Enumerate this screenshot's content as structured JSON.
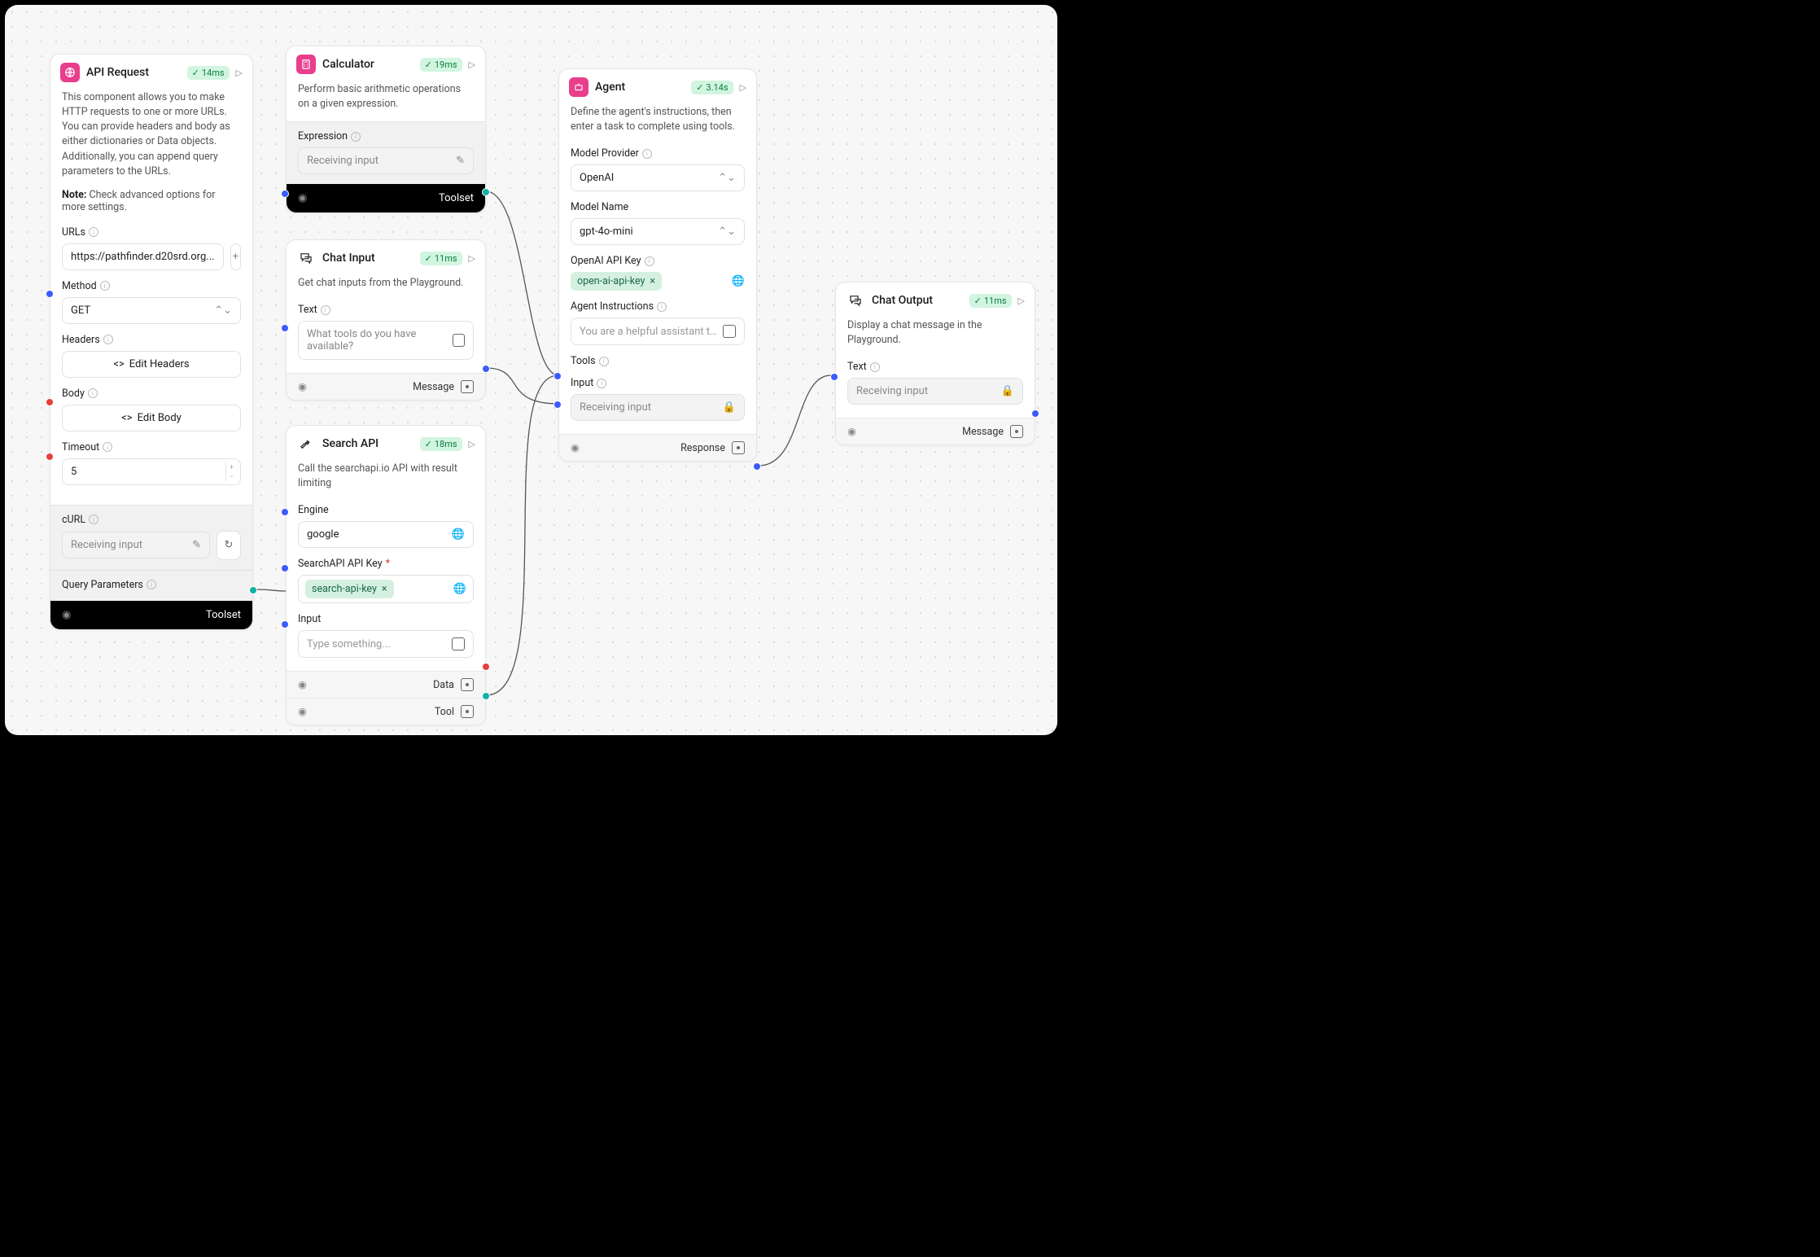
{
  "nodes": {
    "api_request": {
      "title": "API Request",
      "time": "14ms",
      "desc": "This component allows you to make HTTP requests to one or more URLs. You can provide headers and body as either dictionaries or Data objects. Additionally, you can append query parameters to the URLs.",
      "note_bold": "Note:",
      "note_rest": " Check advanced options for more settings.",
      "labels": {
        "urls": "URLs",
        "method": "Method",
        "headers": "Headers",
        "body": "Body",
        "timeout": "Timeout",
        "curl": "cURL",
        "query": "Query Parameters"
      },
      "url_value": "https://pathfinder.d20srd.org...",
      "method_value": "GET",
      "edit_headers": "Edit Headers",
      "edit_body": "Edit Body",
      "timeout_value": "5",
      "curl_value": "Receiving input",
      "toolset": "Toolset"
    },
    "calculator": {
      "title": "Calculator",
      "time": "19ms",
      "desc": "Perform basic arithmetic operations on a given expression.",
      "expr_label": "Expression",
      "expr_value": "Receiving input",
      "toolset": "Toolset"
    },
    "chat_input": {
      "title": "Chat Input",
      "time": "11ms",
      "desc": "Get chat inputs from the Playground.",
      "text_label": "Text",
      "text_value": "What tools do you have available?",
      "message": "Message"
    },
    "search_api": {
      "title": "Search API",
      "time": "18ms",
      "desc": "Call the searchapi.io API with result limiting",
      "engine_label": "Engine",
      "engine_value": "google",
      "key_label": "SearchAPI API Key",
      "key_chip": "search-api-key",
      "input_label": "Input",
      "input_value": "Type something...",
      "data": "Data",
      "tool": "Tool"
    },
    "agent": {
      "title": "Agent",
      "time": "3.14s",
      "desc": "Define the agent's instructions, then enter a task to complete using tools.",
      "provider_label": "Model Provider",
      "provider_value": "OpenAI",
      "model_label": "Model Name",
      "model_value": "gpt-4o-mini",
      "key_label": "OpenAI API Key",
      "key_chip": "open-ai-api-key",
      "instr_label": "Agent Instructions",
      "instr_value": "You are a helpful assistant that can",
      "tools_label": "Tools",
      "input_label": "Input",
      "input_value": "Receiving input",
      "response": "Response"
    },
    "chat_output": {
      "title": "Chat Output",
      "time": "11ms",
      "desc": "Display a chat message in the Playground.",
      "text_label": "Text",
      "text_value": "Receiving input",
      "message": "Message"
    }
  }
}
